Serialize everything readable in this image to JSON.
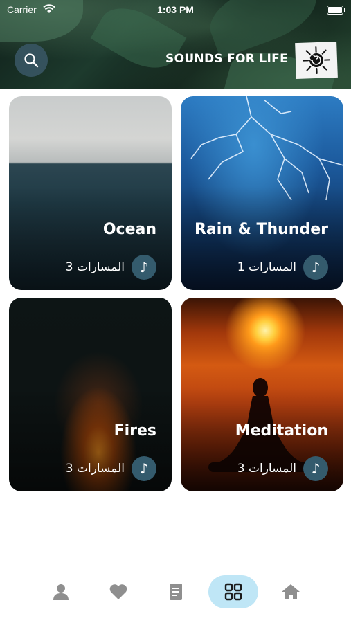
{
  "status_bar": {
    "carrier": "Carrier",
    "time": "1:03 PM"
  },
  "header": {
    "title": "SOUNDS FOR LIFE",
    "search_icon": "search-icon",
    "logo": "spiral-logo"
  },
  "categories": [
    {
      "title": "Ocean",
      "tracks_label": "المسارات 3"
    },
    {
      "title": "Rain & Thunder",
      "tracks_label": "المسارات 1"
    },
    {
      "title": "Fires",
      "tracks_label": "المسارات 3"
    },
    {
      "title": "Meditation",
      "tracks_label": "المسارات 3"
    }
  ],
  "bottom_nav": {
    "items": [
      {
        "icon": "profile-icon",
        "active": false
      },
      {
        "icon": "heart-icon",
        "active": false
      },
      {
        "icon": "book-icon",
        "active": false
      },
      {
        "icon": "grid-icon",
        "active": true
      },
      {
        "icon": "home-icon",
        "active": false
      }
    ]
  },
  "colors": {
    "accent": "#345b6d",
    "nav_active_bg": "#bfe6f6",
    "nav_icon": "#8f8f8f"
  }
}
